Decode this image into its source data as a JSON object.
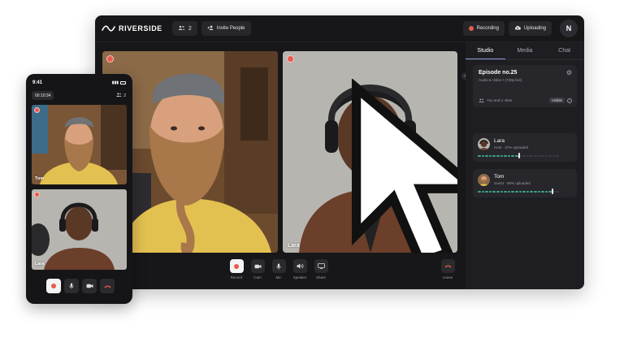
{
  "app": {
    "brand": "RIVERSIDE",
    "participant_count": "2",
    "invite_label": "Invite People",
    "recording_label": "Recording",
    "uploading_label": "Uploading",
    "user_initial": "N"
  },
  "stage": {
    "tiles": [
      {
        "name": ""
      },
      {
        "name": "Lara"
      }
    ]
  },
  "controls": {
    "record": "Record",
    "cam": "Cam",
    "mic": "Mic",
    "speaker": "Speaker",
    "share": "Share",
    "leave": "Leave"
  },
  "sidebar": {
    "tabs": [
      "Studio",
      "Media",
      "Chat"
    ],
    "active_tab": "Studio",
    "episode": {
      "title": "Episode no.25",
      "subtitle": "Audio & Video • (720p live)",
      "people_line": "You and 1 other",
      "visibility": "Visible"
    },
    "participants": [
      {
        "name": "Lara",
        "status": "Host · 37% uploaded",
        "progress": 0.37
      },
      {
        "name": "Tom",
        "status": "Guest · 69% uploaded",
        "progress": 0.69
      }
    ]
  },
  "phone": {
    "time": "9:41",
    "timer": "00:10:34",
    "people_count": "2",
    "tiles": [
      {
        "name": "Tom"
      },
      {
        "name": "Lara"
      }
    ]
  },
  "colors": {
    "accent_red": "#e85a4f",
    "progress_green": "#3fa38a",
    "tab_underline": "#8e9bd8"
  }
}
